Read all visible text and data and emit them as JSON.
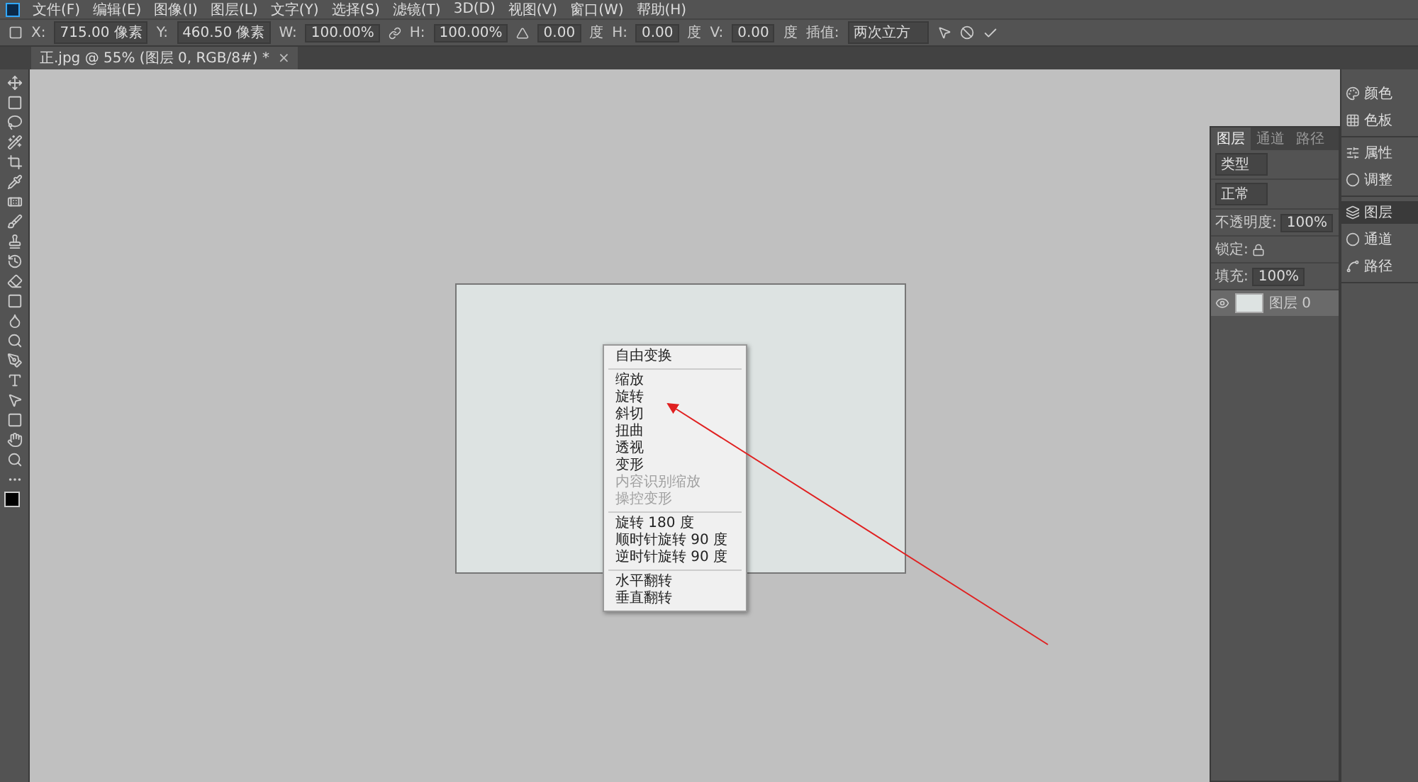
{
  "menu_bar": [
    "文件(F)",
    "编辑(E)",
    "图像(I)",
    "图层(L)",
    "文字(Y)",
    "选择(S)",
    "滤镜(T)",
    "3D(D)",
    "视图(V)",
    "窗口(W)",
    "帮助(H)"
  ],
  "options_bar": {
    "fields": [
      {
        "label": "X:",
        "value": "715.00 像素"
      },
      {
        "label": "Y:",
        "value": "460.50 像素"
      },
      {
        "label": "W:",
        "value": "100.00%"
      },
      {
        "label": "H:",
        "value": "100.00%"
      },
      {
        "value": "0.00",
        "unit": "度"
      },
      {
        "label": "H:",
        "value": "0.00",
        "unit": "度"
      },
      {
        "label": "V:",
        "value": "0.00",
        "unit": "度"
      }
    ],
    "interpolation_label": "插值:",
    "interpolation": "两次立方"
  },
  "document_tab": {
    "title": "正.jpg @ 55% (图层 0, RGB/8#) *",
    "close": "×"
  },
  "context_menu": {
    "groups": [
      [
        {
          "label": "自由变换",
          "disabled": false
        }
      ],
      [
        {
          "label": "缩放",
          "disabled": false
        },
        {
          "label": "旋转",
          "disabled": false
        },
        {
          "label": "斜切",
          "disabled": false
        },
        {
          "label": "扭曲",
          "disabled": false
        },
        {
          "label": "透视",
          "disabled": false
        },
        {
          "label": "变形",
          "disabled": false
        },
        {
          "label": "内容识别缩放",
          "disabled": true
        },
        {
          "label": "操控变形",
          "disabled": true
        }
      ],
      [
        {
          "label": "旋转 180 度",
          "disabled": false
        },
        {
          "label": "顺时针旋转 90 度",
          "disabled": false
        },
        {
          "label": "逆时针旋转 90 度",
          "disabled": false
        }
      ],
      [
        {
          "label": "水平翻转",
          "disabled": false
        },
        {
          "label": "垂直翻转",
          "disabled": false
        }
      ]
    ]
  },
  "layers_panel": {
    "tabs": [
      {
        "label": "图层",
        "selected": true
      },
      {
        "label": "通道",
        "selected": false
      },
      {
        "label": "路径",
        "selected": false
      }
    ],
    "filter": "类型",
    "blend_mode": "正常",
    "opacity_label": "不透明度:",
    "opacity": "100%",
    "lock_label": "锁定:",
    "fill_label": "填充:",
    "fill": "100%",
    "layers": [
      {
        "name": "图层 0",
        "visible": true,
        "selected": true
      }
    ]
  },
  "dock": {
    "groups": [
      [
        {
          "label": "颜色"
        },
        {
          "label": "色板"
        }
      ],
      [
        {
          "label": "属性"
        },
        {
          "label": "调整"
        }
      ],
      [
        {
          "label": "图层",
          "selected": true
        },
        {
          "label": "通道",
          "selected": false
        },
        {
          "label": "路径",
          "selected": false
        }
      ]
    ]
  }
}
